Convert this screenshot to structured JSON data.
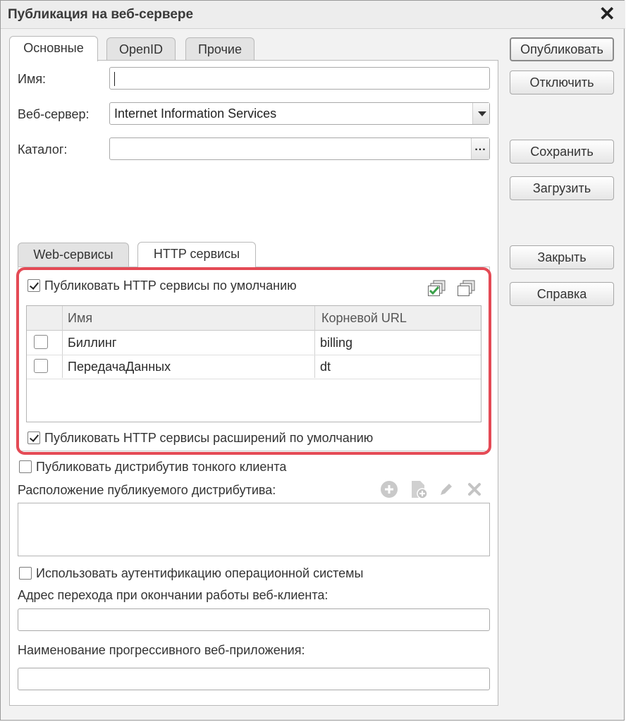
{
  "window": {
    "title": "Публикация на веб-сервере"
  },
  "tabs": [
    {
      "label": "Основные",
      "active": true
    },
    {
      "label": "OpenID",
      "active": false
    },
    {
      "label": "Прочие",
      "active": false
    }
  ],
  "form": {
    "name_label": "Имя:",
    "name_value": "",
    "webserver_label": "Веб-сервер:",
    "webserver_value": "Internet Information Services",
    "catalog_label": "Каталог:",
    "catalog_value": "",
    "catalog_button": "..."
  },
  "buttons": {
    "publish": "Опубликовать",
    "disable": "Отключить",
    "save": "Сохранить",
    "load": "Загрузить",
    "close": "Закрыть",
    "help": "Справка"
  },
  "sub_tabs": [
    {
      "label": "Web-сервисы",
      "active": false
    },
    {
      "label": "HTTP сервисы",
      "active": true
    }
  ],
  "http": {
    "publish_default_label": "Публиковать HTTP сервисы по умолчанию",
    "publish_default_checked": true,
    "columns": [
      "Имя",
      "Корневой URL"
    ],
    "rows": [
      {
        "name": "Биллинг",
        "url": "billing",
        "checked": false
      },
      {
        "name": "ПередачаДанных",
        "url": "dt",
        "checked": false
      }
    ],
    "publish_extensions_label": "Публиковать HTTP сервисы расширений по умолчанию",
    "publish_extensions_checked": true
  },
  "distribution": {
    "publish_thin_client_label": "Публиковать дистрибутив тонкого клиента",
    "publish_thin_client_checked": false,
    "location_label": "Расположение публикуемого дистрибутива:"
  },
  "auth": {
    "os_auth_label": "Использовать аутентификацию операционной системы",
    "os_auth_checked": false,
    "exit_address_label": "Адрес перехода при окончании работы веб-клиента:",
    "exit_address_value": "",
    "pwa_name_label": "Наименование прогрессивного веб-приложения:",
    "pwa_name_value": ""
  },
  "colors": {
    "highlight": "#e44a55",
    "check_green": "#3aa14a"
  }
}
